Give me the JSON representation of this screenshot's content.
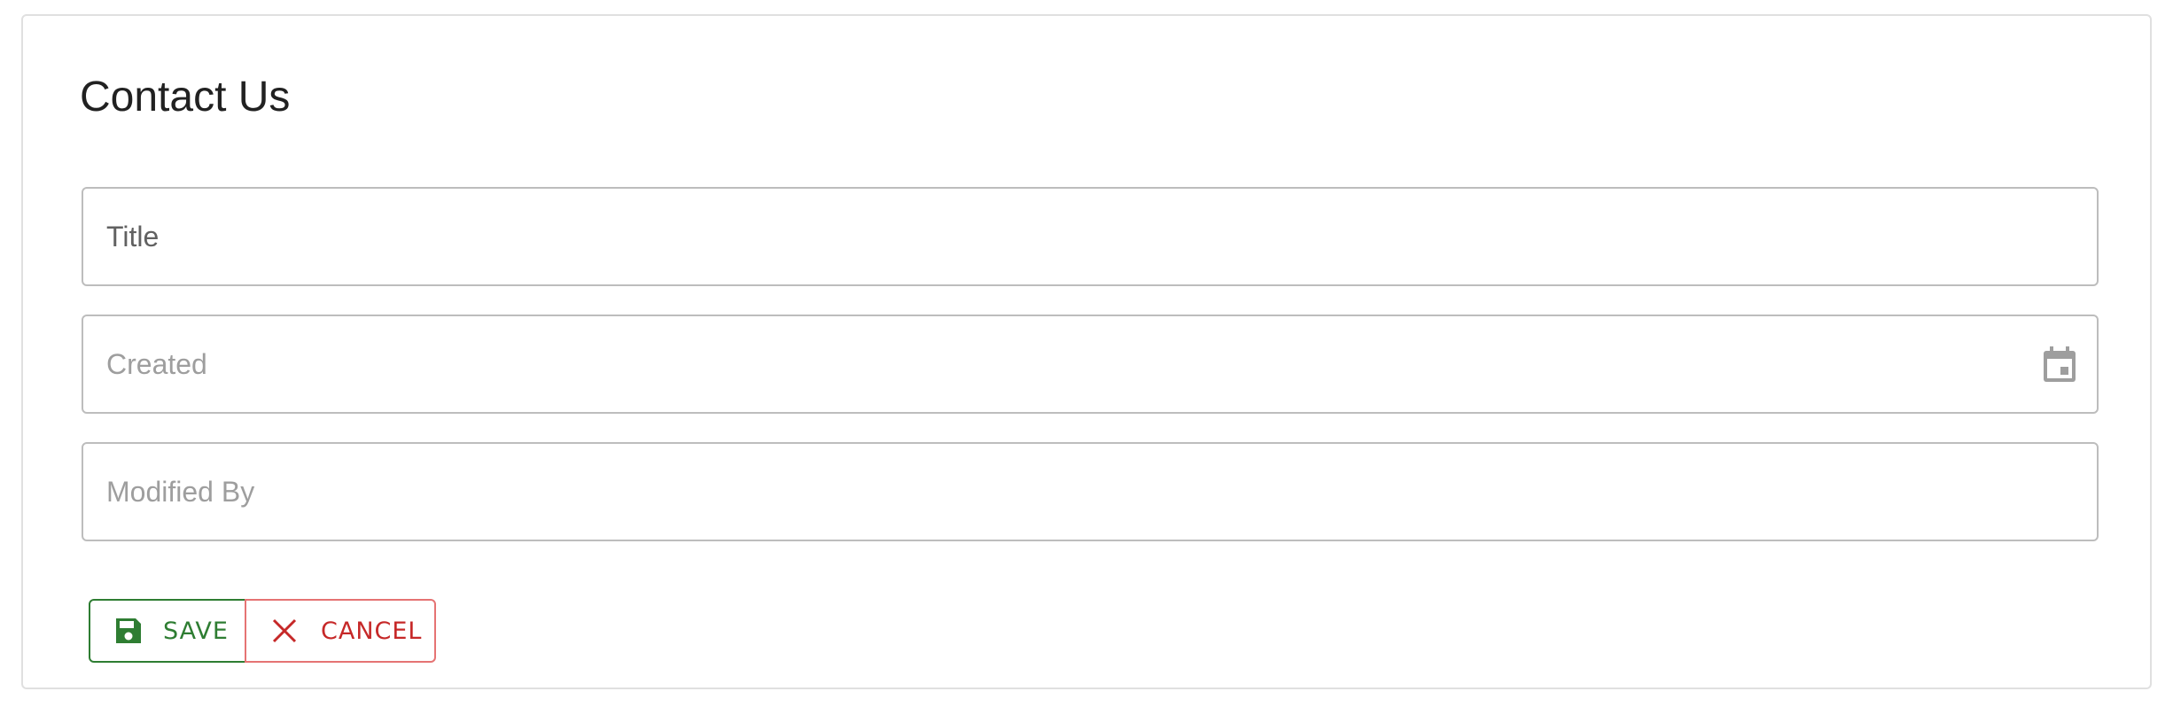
{
  "form": {
    "title": "Contact Us",
    "fields": [
      {
        "name": "title",
        "placeholder": "Title",
        "value": ""
      },
      {
        "name": "created",
        "placeholder": "Created",
        "value": "",
        "icon": "calendar-icon"
      },
      {
        "name": "modified_by",
        "placeholder": "Modified By",
        "value": ""
      }
    ]
  },
  "actions": {
    "save_label": "SAVE",
    "save_icon": "save-icon",
    "cancel_label": "CANCEL",
    "cancel_icon": "close-icon"
  },
  "colors": {
    "save": "#2e7d32",
    "cancel": "#c62828",
    "cancel_border": "#e57373",
    "field_border": "#bdbdbd",
    "icon_gray": "#9e9e9e"
  }
}
